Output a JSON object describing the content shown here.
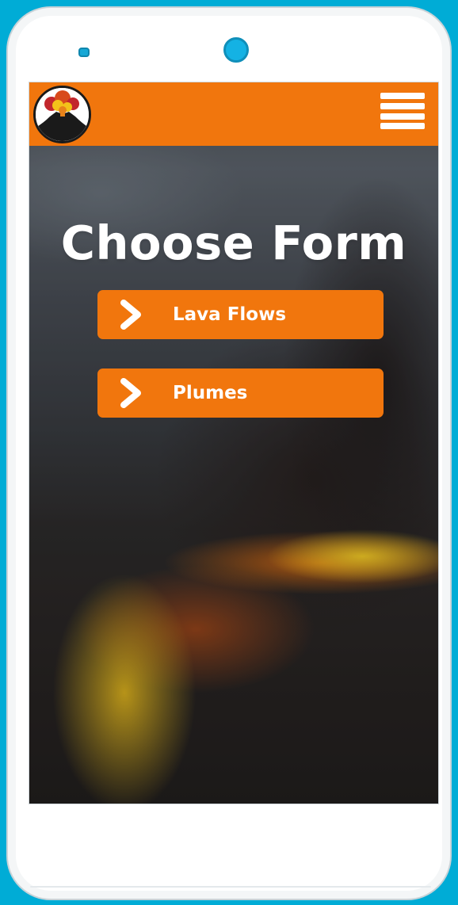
{
  "page": {
    "title": "Choose Form"
  },
  "menu": {
    "icon": "hamburger-menu-icon"
  },
  "logo": {
    "icon": "volcano-logo"
  },
  "forms": [
    {
      "label": "Lava Flows",
      "icon": "chevron-right-icon"
    },
    {
      "label": "Plumes",
      "icon": "chevron-right-icon"
    }
  ],
  "colors": {
    "accent": "#f1760d",
    "frame_background": "#00acd6",
    "text": "#ffffff"
  }
}
